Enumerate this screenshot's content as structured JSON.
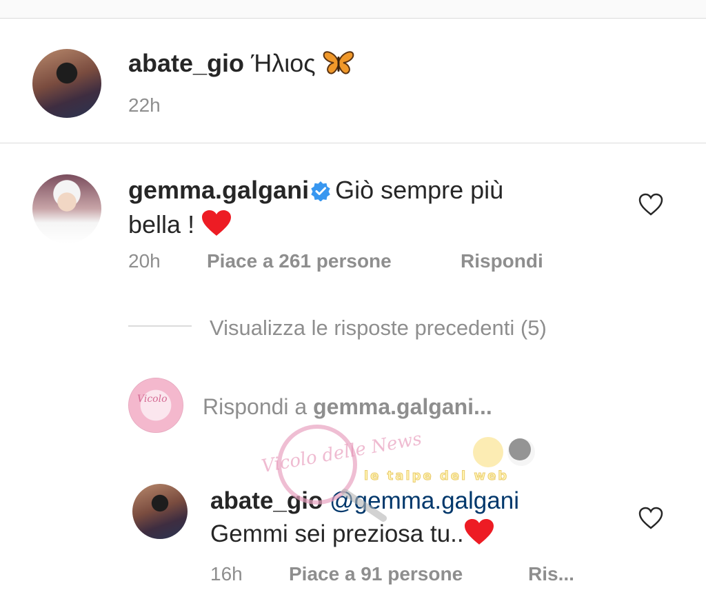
{
  "caption": {
    "username": "abate_gio",
    "text": "Ήλιος",
    "emoji_icon": "butterfly-icon",
    "time": "22h"
  },
  "comment": {
    "username": "gemma.galgani",
    "verified_icon": "verified-badge-icon",
    "text_line1": "Giò sempre più",
    "text_line2": "bella !",
    "emoji_icon": "red-heart-icon",
    "time": "20h",
    "likes": "Piace a 261 persone",
    "reply_label": "Rispondi",
    "like_icon": "heart-outline-icon"
  },
  "view_replies": {
    "label": "Visualizza le risposte precedenti (5)"
  },
  "reply_input": {
    "prefix": "Rispondi a ",
    "target": "gemma.galgani",
    "suffix": "..."
  },
  "reply": {
    "username": "abate_gio",
    "mention": "@gemma.galgani",
    "text": "Gemmi sei preziosa tu..",
    "emoji_icon": "red-heart-icon",
    "time": "16h",
    "likes": "Piace a 91 persone",
    "reply_label": "Ris...",
    "like_icon": "heart-outline-icon"
  },
  "watermark": {
    "text1": "Vicolo delle News",
    "text2": "le talpe del web"
  },
  "colors": {
    "text": "#262626",
    "muted": "#8e8e8e",
    "mention": "#00376b",
    "verified": "#3897f0",
    "heart": "#ed1c24",
    "divider": "#dbdbdb"
  }
}
